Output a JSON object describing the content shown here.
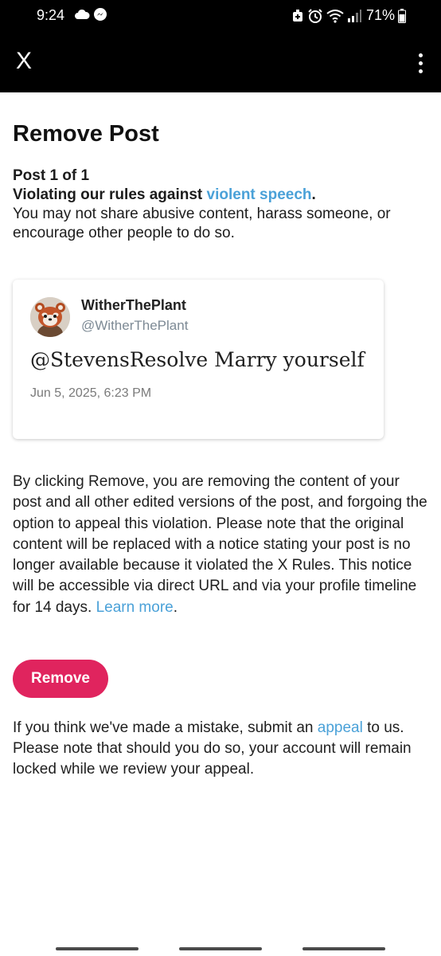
{
  "status_bar": {
    "time": "9:24",
    "battery": "71%",
    "left_icons": [
      "cloud-icon",
      "messenger-icon"
    ],
    "right_icons": [
      "alarm-icon",
      "clock-icon",
      "wifi-icon",
      "signal-icon",
      "battery-icon"
    ]
  },
  "app_bar": {
    "close_label": "X"
  },
  "page": {
    "title": "Remove Post",
    "post_count": "Post 1 of 1",
    "violation_prefix": "Violating our rules against ",
    "violation_link": "violent speech",
    "violation_suffix": ".",
    "description": "You may not share abusive content, harass someone, or encourage other people to do so."
  },
  "post": {
    "display_name": "WitherThePlant",
    "handle": "@WitherThePlant",
    "text": "@StevensResolve Marry yourself",
    "date": "Jun 5, 2025, 6:23 PM"
  },
  "notice": {
    "text": "By clicking Remove, you are removing the content of your post and all other edited versions of the post, and forgoing the option to appeal this violation. Please note that the original content will be replaced with a notice stating your post is no longer available because it violated the X Rules. This notice will be accessible via direct URL and via your profile timeline for 14 days. ",
    "learn_more": "Learn more",
    "period": "."
  },
  "remove_button": "Remove",
  "appeal": {
    "prefix": "If you think we've made a mistake, submit an ",
    "link": "appeal",
    "suffix": " to us. Please note that should you do so, your account will remain locked while we review your appeal."
  },
  "colors": {
    "accent_link": "#4aa1d8",
    "remove_button": "#e0245e",
    "header_bg": "#000000"
  }
}
